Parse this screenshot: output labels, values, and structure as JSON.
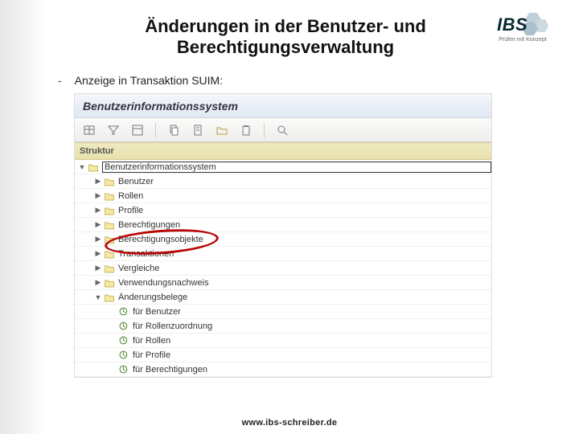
{
  "title": "Änderungen in der Benutzer- und Berechtigungsverwaltung",
  "logo": {
    "main": "IBS",
    "sub": "Prüfen mit Konzept"
  },
  "bullet": {
    "dash": "-",
    "text": "Anzeige in Transaktion SUIM:"
  },
  "screenshot": {
    "header_title": "Benutzerinformationssystem",
    "column_header": "Struktur",
    "toolbar_icons": [
      "table-icon",
      "filter-icon",
      "layout-icon",
      "sep",
      "copy-icon",
      "page-icon",
      "folder-icon",
      "clipboard-icon",
      "sep",
      "search-icon"
    ],
    "tree_root": "Benutzerinformationssystem",
    "tree": [
      {
        "level": 1,
        "exp": "▶",
        "label": "Benutzer"
      },
      {
        "level": 1,
        "exp": "▶",
        "label": "Rollen"
      },
      {
        "level": 1,
        "exp": "▶",
        "label": "Profile"
      },
      {
        "level": 1,
        "exp": "▶",
        "label": "Berechtigungen"
      },
      {
        "level": 1,
        "exp": "▶",
        "label": "Berechtigungsobjekte"
      },
      {
        "level": 1,
        "exp": "▶",
        "label": "Transaktionen"
      },
      {
        "level": 1,
        "exp": "▶",
        "label": "Vergleiche"
      },
      {
        "level": 1,
        "exp": "▶",
        "label": "Verwendungsnachweis"
      },
      {
        "level": 1,
        "exp": "▼",
        "label": "Änderungsbelege"
      },
      {
        "level": 2,
        "doc": true,
        "label": "für Benutzer"
      },
      {
        "level": 2,
        "doc": true,
        "label": "für Rollenzuordnung"
      },
      {
        "level": 2,
        "doc": true,
        "label": "für Rollen"
      },
      {
        "level": 2,
        "doc": true,
        "label": "für Profile"
      },
      {
        "level": 2,
        "doc": true,
        "label": "für Berechtigungen"
      }
    ]
  },
  "footer": "www.ibs-schreiber.de"
}
